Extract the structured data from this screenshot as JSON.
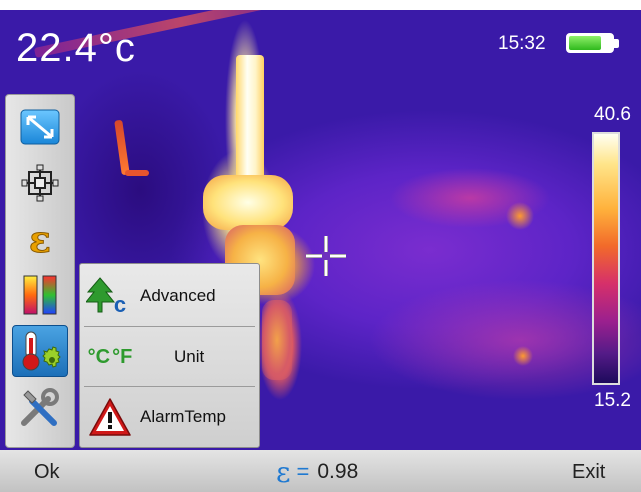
{
  "status": {
    "temperature": "22.4°c",
    "time": "15:32",
    "battery_level": 0.75
  },
  "colors": {
    "accent": "#1f79d1",
    "battery": "#2fb91d",
    "alarm": "#d01818"
  },
  "scale": {
    "max": "40.6",
    "min": "15.2"
  },
  "toolbar": {
    "items": [
      {
        "icon": "zoom-arrows-icon"
      },
      {
        "icon": "measure-point-icon"
      },
      {
        "icon": "emissivity-icon"
      },
      {
        "icon": "palette-icon"
      },
      {
        "icon": "thermometer-settings-icon",
        "selected": true
      },
      {
        "icon": "tools-icon"
      }
    ]
  },
  "submenu": {
    "items": [
      {
        "label": "Advanced",
        "icon": "advanced-tree-icon"
      },
      {
        "label": "Unit",
        "icon": "celsius-fahrenheit-icon",
        "glyph_c": "°C",
        "glyph_f": "°F"
      },
      {
        "label": "AlarmTemp",
        "icon": "alarm-warning-icon"
      }
    ]
  },
  "bottom_bar": {
    "ok_label": "Ok",
    "emissivity_symbol": "ε",
    "emissivity_equals": "=",
    "emissivity_value": "0.98",
    "exit_label": "Exit"
  }
}
